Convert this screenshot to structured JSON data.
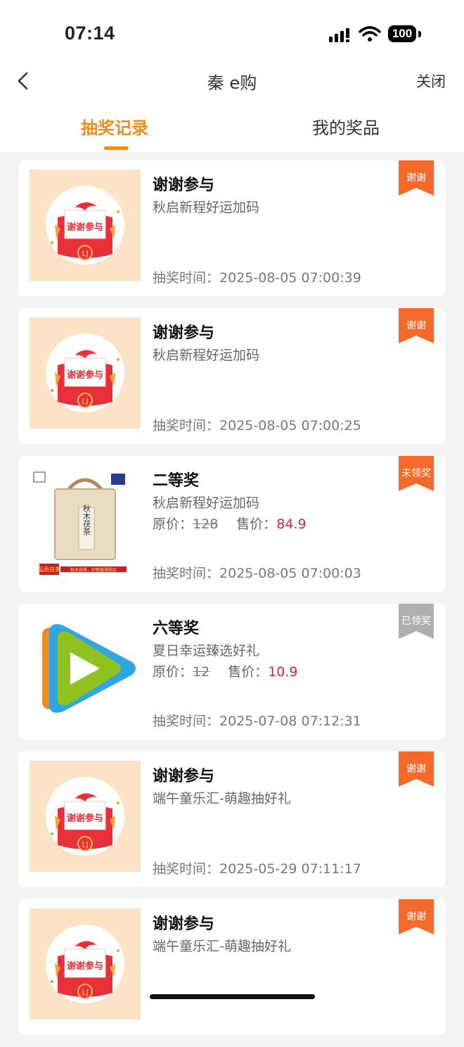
{
  "status": {
    "time": "07:14",
    "battery": "100"
  },
  "nav": {
    "title": "秦 e购",
    "close_label": "关闭"
  },
  "tabs": [
    {
      "label": "抽奖记录"
    },
    {
      "label": "我的奖品"
    }
  ],
  "labels": {
    "price_label": "原价：",
    "sale_label": "售价：",
    "time_label": "抽奖时间："
  },
  "icons": {
    "back": "chevron-left-icon",
    "signal": "cellular-signal-icon",
    "wifi": "wifi-icon",
    "battery": "battery-icon"
  },
  "colors": {
    "accent": "#f08c1a",
    "ribbon_orange": "#f46a2a",
    "ribbon_gray": "#b0b0b0",
    "sale_price": "#d6204a"
  },
  "records": [
    {
      "title": "谢谢参与",
      "activity": "秋启新程好运加码",
      "time": "2025-08-05 07:00:39",
      "badge": "谢谢"
    },
    {
      "title": "谢谢参与",
      "activity": "秋启新程好运加码",
      "time": "2025-08-05 07:00:25",
      "badge": "谢谢"
    },
    {
      "title": "二等奖",
      "activity": "秋启新程好运加码",
      "original_price": "128",
      "sale_price": "84.9",
      "time": "2025-08-05 07:00:03",
      "badge": "未领奖",
      "image_text": {
        "product": "秋木茯茶",
        "banner": "品质茯茶",
        "slogan": "秋木茯茶，好物值得购买"
      }
    },
    {
      "title": "六等奖",
      "activity": "夏日幸运臻选好礼",
      "original_price": "12",
      "sale_price": "10.9",
      "time": "2025-07-08 07:12:31",
      "badge": "已领奖"
    },
    {
      "title": "谢谢参与",
      "activity": "端午童乐汇-萌趣抽好礼",
      "time": "2025-05-29 07:11:17",
      "badge": "谢谢"
    },
    {
      "title": "谢谢参与",
      "activity": "端午童乐汇-萌趣抽好礼",
      "badge": "谢谢"
    }
  ],
  "thanks_image_text": "谢谢参与"
}
